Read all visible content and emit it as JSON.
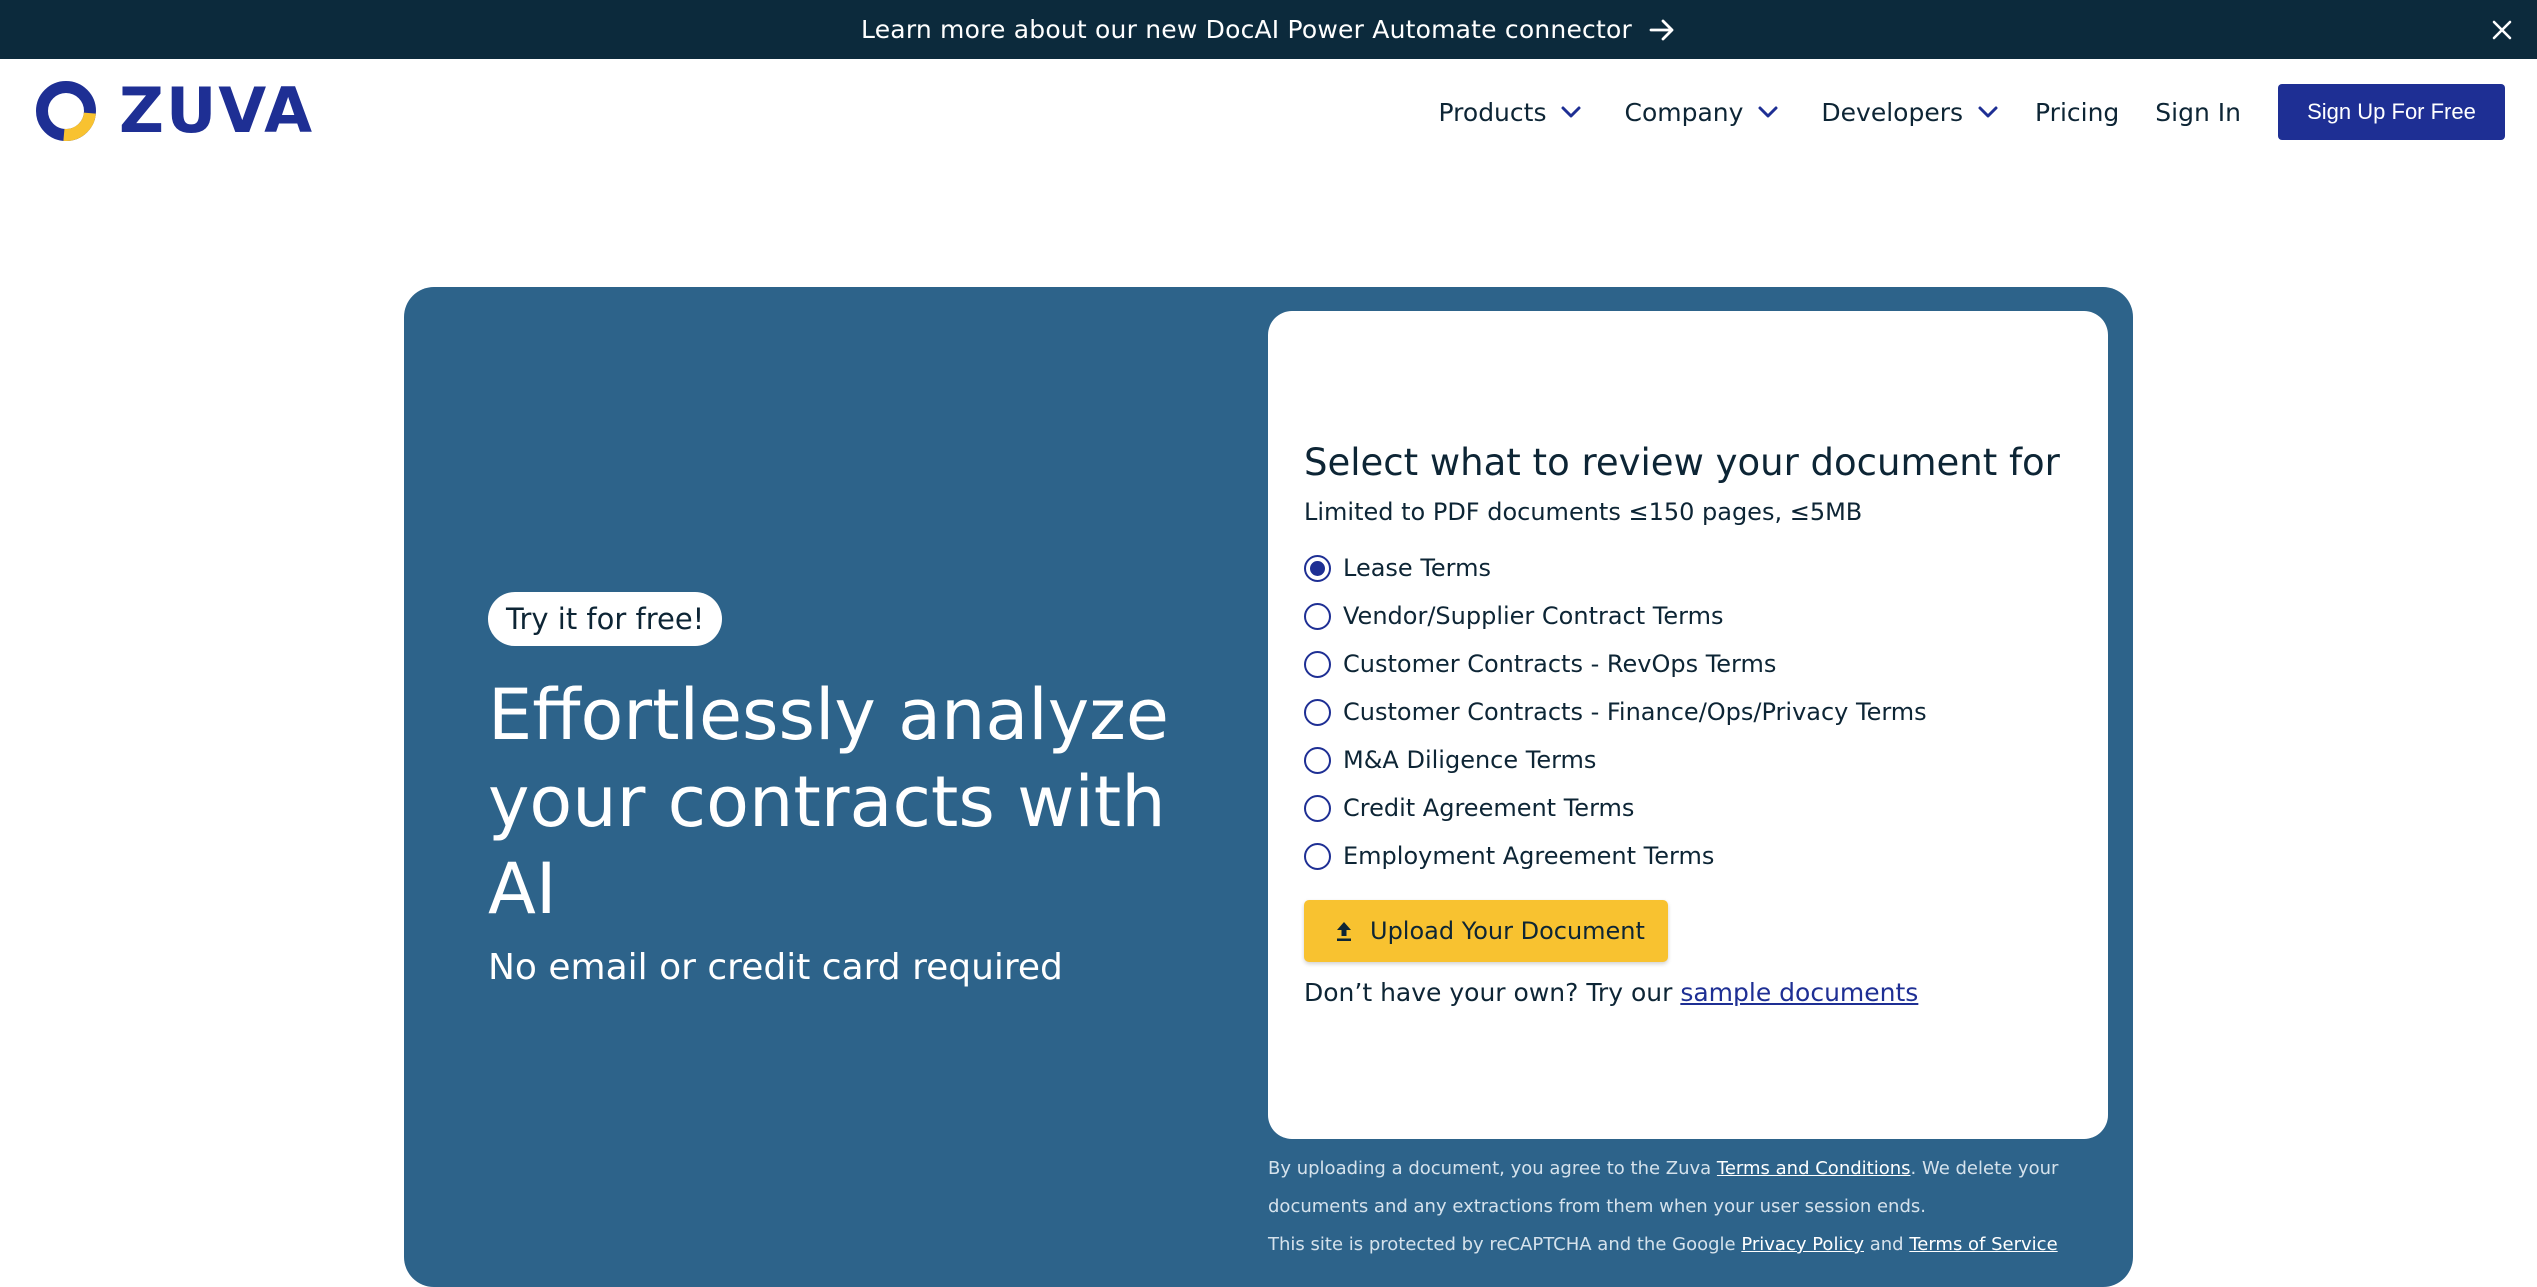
{
  "announcement": {
    "text": "Learn more about our new DocAI Power Automate connector"
  },
  "brand": {
    "name": "ZUVA",
    "primary_color": "#1e2f94",
    "accent_color": "#f8c230"
  },
  "nav": {
    "items": [
      {
        "label": "Products"
      },
      {
        "label": "Company"
      },
      {
        "label": "Developers"
      }
    ],
    "pricing": "Pricing",
    "sign_in": "Sign In",
    "sign_up": "Sign Up For Free"
  },
  "hero": {
    "badge": "Try it for free!",
    "title": "Effortlessly analyze your contracts with AI",
    "subtitle": "No email or credit card required",
    "background_color": "#2d638a"
  },
  "review_card": {
    "title": "Select what to review your document for",
    "limit": "Limited to PDF documents ≤150 pages, ≤5MB",
    "options": [
      {
        "label": "Lease Terms",
        "selected": true
      },
      {
        "label": "Vendor/Supplier Contract Terms",
        "selected": false
      },
      {
        "label": "Customer Contracts - RevOps Terms",
        "selected": false
      },
      {
        "label": "Customer Contracts - Finance/Ops/Privacy Terms",
        "selected": false
      },
      {
        "label": "M&A Diligence Terms",
        "selected": false
      },
      {
        "label": "Credit Agreement Terms",
        "selected": false
      },
      {
        "label": "Employment Agreement Terms",
        "selected": false
      }
    ],
    "upload_button": "Upload Your Document",
    "sample_prefix": "Don’t have your own? Try our ",
    "sample_link": "sample documents"
  },
  "fine_print": {
    "line1_prefix": "By uploading a document, you agree to the Zuva ",
    "terms_link": "Terms and Conditions",
    "line1_suffix": ". We delete your documents and any extractions from them when your user session ends.",
    "line2_prefix": "This site is protected by reCAPTCHA and the Google ",
    "privacy_link": "Privacy Policy",
    "line2_mid": " and ",
    "tos_link": "Terms of Service"
  }
}
